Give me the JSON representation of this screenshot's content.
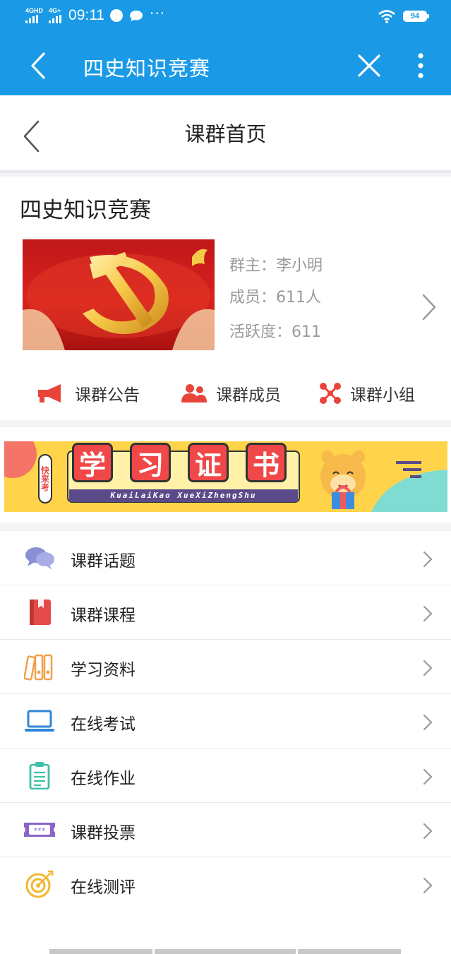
{
  "status_bar": {
    "network_1": "4GHD",
    "network_2": "4G+",
    "time": "09:11",
    "more_dots": "···",
    "battery": "94"
  },
  "top_bar": {
    "title": "四史知识竞赛",
    "back_icon": "chevron-left-icon",
    "close_icon": "close-icon",
    "more_icon": "more-vertical-icon"
  },
  "page_header": {
    "title": "课群首页"
  },
  "group": {
    "name": "四史知识竞赛",
    "owner": "群主：李小明",
    "members": "成员：611人",
    "activity": "活跃度：611"
  },
  "quick_actions": [
    {
      "label": "课群公告",
      "icon": "megaphone-icon",
      "color": "#e8443a"
    },
    {
      "label": "课群成员",
      "icon": "members-icon",
      "color": "#e8443a"
    },
    {
      "label": "课群小组",
      "icon": "network-icon",
      "color": "#e8443a"
    }
  ],
  "promo_banner": {
    "side_text": "快来考",
    "title_chars": [
      "学",
      "习",
      "证",
      "书"
    ],
    "subtitle": "KuaiLaiKao XueXiZhengShu"
  },
  "menu": [
    {
      "label": "课群话题",
      "icon": "chat-bubbles-icon",
      "color": "#8a8fd6"
    },
    {
      "label": "课群课程",
      "icon": "book-icon",
      "color": "#e54a4a"
    },
    {
      "label": "学习资料",
      "icon": "binders-icon",
      "color": "#f0a04b"
    },
    {
      "label": "在线考试",
      "icon": "laptop-icon",
      "color": "#2f86d6"
    },
    {
      "label": "在线作业",
      "icon": "clipboard-icon",
      "color": "#3fbfa6"
    },
    {
      "label": "课群投票",
      "icon": "ticket-icon",
      "color": "#8b63c9"
    },
    {
      "label": "在线测评",
      "icon": "target-icon",
      "color": "#f2b72f"
    }
  ],
  "colors": {
    "primary": "#1a9ae6",
    "accent_red": "#e8443a",
    "muted_text": "#9a9a9a"
  }
}
